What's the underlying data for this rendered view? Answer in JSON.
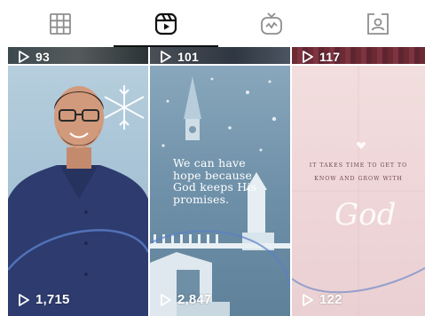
{
  "tabs": [
    {
      "name": "grid",
      "icon": "grid-icon",
      "selected": false
    },
    {
      "name": "reels",
      "icon": "reels-icon",
      "selected": true
    },
    {
      "name": "tv",
      "icon": "tv-icon",
      "selected": false
    },
    {
      "name": "tagged",
      "icon": "tagged-person-icon",
      "selected": false
    }
  ],
  "top_row": [
    {
      "views": "93"
    },
    {
      "views": "101"
    },
    {
      "views": "117"
    }
  ],
  "reels": [
    {
      "views": "1,715",
      "image": "man-in-blue-shirt-with-snowflake"
    },
    {
      "views": "2,847",
      "caption": "We can have hope because God keeps His promises."
    },
    {
      "views": "122",
      "line1": "IT TAKES TIME TO GET TO",
      "line2": "KNOW AND GROW WITH",
      "script": "God"
    }
  ],
  "colors": {
    "active_tab": "#111111",
    "inactive_tab": "#8e8e8e"
  }
}
